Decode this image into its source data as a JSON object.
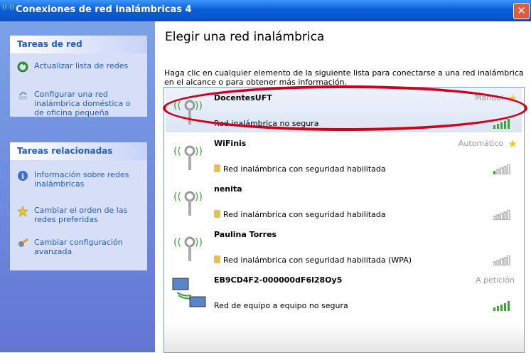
{
  "window": {
    "title": "Conexiones de red inalámbricas 4",
    "close_glyph": "✕"
  },
  "sidebar": {
    "tareas_red": {
      "title": "Tareas de red",
      "items": [
        {
          "label": "Actualizar lista de redes",
          "icon": "refresh-icon"
        },
        {
          "label": "Configurar una red inalámbrica doméstica o de oficina pequeña",
          "icon": "wizard-icon"
        }
      ]
    },
    "tareas_relacionadas": {
      "title": "Tareas relacionadas",
      "items": [
        {
          "label": "Información sobre redes inalámbricas",
          "icon": "info-icon"
        },
        {
          "label": "Cambiar el orden de las redes preferidas",
          "icon": "star-icon"
        },
        {
          "label": "Cambiar configuración avanzada",
          "icon": "settings-icon"
        }
      ]
    }
  },
  "main": {
    "heading": "Elegir una red inalámbrica",
    "instruction": "Haga clic en cualquier elemento de la siguiente lista para conectarse a una red inalámbrica en el alcance o para obtener más información.",
    "networks": [
      {
        "name": "DocentesUFT",
        "mode": "Manual",
        "star": true,
        "status": "Red inalámbrica no segura",
        "secured": false,
        "signal_bars": 5,
        "adhoc": false
      },
      {
        "name": "WiFinis",
        "mode": "Automático",
        "star": true,
        "status": "Red inalámbrica con seguridad habilitada",
        "secured": true,
        "signal_bars": 1,
        "adhoc": false
      },
      {
        "name": "nenita",
        "mode": "",
        "star": false,
        "status": "Red inalámbrica con seguridad habilitada",
        "secured": true,
        "signal_bars": 1,
        "adhoc": false
      },
      {
        "name": "Paulina Torres",
        "mode": "",
        "star": false,
        "status": "Red inalámbrica con seguridad habilitada (WPA)",
        "secured": true,
        "signal_bars": 1,
        "adhoc": false
      },
      {
        "name": "EB9CD4F2-000000dF6l28Oy5",
        "mode": "A petición",
        "star": false,
        "status": "Red de equipo a equipo no segura",
        "secured": false,
        "signal_bars": 5,
        "adhoc": true
      }
    ]
  },
  "colors": {
    "title_blue": "#0a5fd8",
    "link_blue": "#215dc6",
    "annotation_red": "#d0021b",
    "signal_green": "#3aa33a"
  }
}
